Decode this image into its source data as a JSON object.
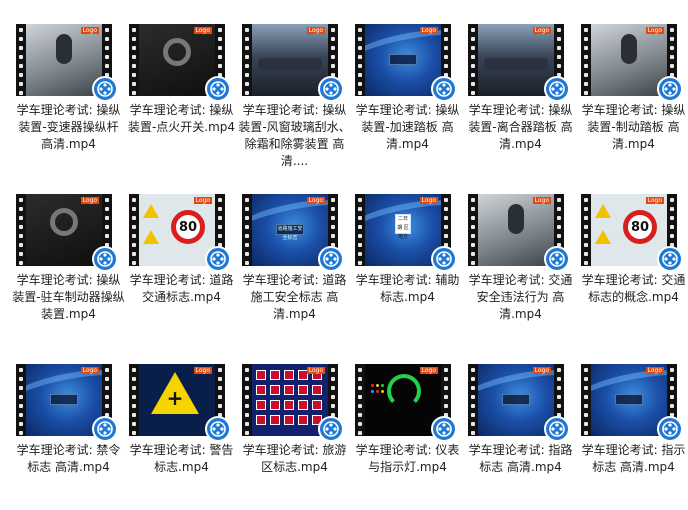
{
  "files": [
    {
      "label": "学车理论考试: 操纵装置-变速器操纵杆 高清.mp4",
      "thumb": "gray"
    },
    {
      "label": "学车理论考试: 操纵装置-点火开关.mp4",
      "thumb": "dark"
    },
    {
      "label": "学车理论考试: 操纵装置-风窗玻璃刮水、除霜和除雾装置 高清....",
      "thumb": "cabin"
    },
    {
      "label": "学车理论考试: 操纵装置-加速踏板 高清.mp4",
      "thumb": "blue"
    },
    {
      "label": "学车理论考试: 操纵装置-离合器踏板 高清.mp4",
      "thumb": "cabin"
    },
    {
      "label": "学车理论考试: 操纵装置-制动踏板 高清.mp4",
      "thumb": "gray"
    },
    {
      "label": "学车理论考试: 操纵装置-驻车制动器操纵装置.mp4",
      "thumb": "dark"
    },
    {
      "label": "学车理论考试: 道路交通标志.mp4",
      "thumb": "sign"
    },
    {
      "label": "学车理论考试: 道路施工安全标志 高清.mp4",
      "thumb": "blue"
    },
    {
      "label": "学车理论考试: 辅助标志.mp4",
      "thumb": "blue"
    },
    {
      "label": "学车理论考试: 交通安全违法行为 高清.mp4",
      "thumb": "gray"
    },
    {
      "label": "学车理论考试: 交通标志的概念.mp4",
      "thumb": "sign"
    },
    {
      "label": "学车理论考试: 禁令标志 高清.mp4",
      "thumb": "blue"
    },
    {
      "label": "学车理论考试: 警告标志.mp4",
      "thumb": "yellowbig"
    },
    {
      "label": "学车理论考试: 旅游区标志.mp4",
      "thumb": "tourgrid"
    },
    {
      "label": "学车理论考试: 仪表与指示灯.mp4",
      "thumb": "dash"
    },
    {
      "label": "学车理论考试: 指路标志 高清.mp4",
      "thumb": "blue"
    },
    {
      "label": "学车理论考试: 指示标志 高清.mp4",
      "thumb": "blue"
    }
  ],
  "thumb_texts": {
    "speed_value": "80",
    "logo_text": "Logo",
    "title_b3": "道路施工安全标志",
    "aux_sign": "二日期 区地方"
  },
  "colors": {
    "badge": "#1d78d6",
    "sign_red": "#d81e1e",
    "warning_yellow": "#f6d400"
  }
}
